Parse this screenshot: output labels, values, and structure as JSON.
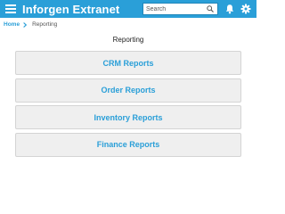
{
  "header": {
    "app_title": "Inforgen Extranet",
    "search_placeholder": "Search",
    "icons": [
      "menu-icon",
      "search-icon",
      "bell-icon",
      "gear-icon"
    ],
    "bar_color": "#2a9fd8"
  },
  "breadcrumb": {
    "home": "Home",
    "current": "Reporting"
  },
  "page": {
    "title": "Reporting"
  },
  "reports": [
    {
      "label": "CRM Reports"
    },
    {
      "label": "Order Reports"
    },
    {
      "label": "Inventory Reports"
    },
    {
      "label": "Finance Reports"
    }
  ],
  "accent_color": "#2a9fd8"
}
